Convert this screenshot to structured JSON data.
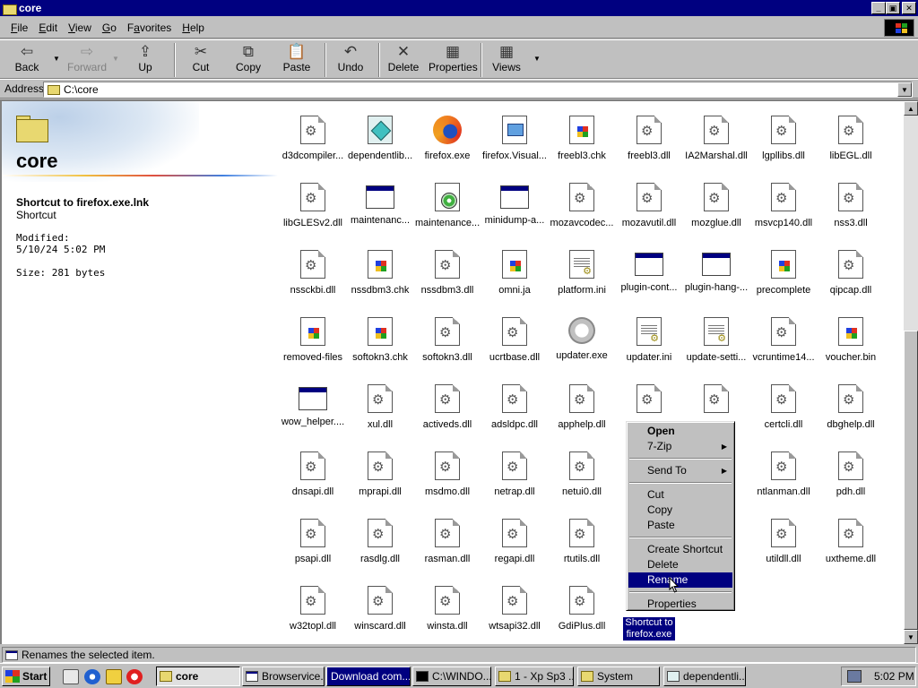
{
  "window": {
    "title": "core",
    "controls": {
      "minimize": "_",
      "maximize": "▣",
      "close": "✕"
    }
  },
  "menubar": {
    "items": [
      {
        "label": "File",
        "mnemonic": "F",
        "rest": "ile"
      },
      {
        "label": "Edit",
        "mnemonic": "E",
        "rest": "dit"
      },
      {
        "label": "View",
        "mnemonic": "V",
        "rest": "iew"
      },
      {
        "label": "Go",
        "mnemonic": "G",
        "rest": "o"
      },
      {
        "label": "Favorites",
        "mnemonic": "a",
        "pre": "F",
        "rest": "vorites"
      },
      {
        "label": "Help",
        "mnemonic": "H",
        "rest": "elp"
      }
    ]
  },
  "toolbar": {
    "back": "Back",
    "forward": "Forward",
    "up": "Up",
    "cut": "Cut",
    "copy": "Copy",
    "paste": "Paste",
    "undo": "Undo",
    "delete": "Delete",
    "properties": "Properties",
    "views": "Views"
  },
  "address": {
    "label": "Address",
    "value": "C:\\core"
  },
  "leftpane": {
    "folder_name": "core",
    "selected_name": "Shortcut to firefox.exe.lnk",
    "selected_type": "Shortcut",
    "modified_label": "Modified:",
    "modified_value": "5/10/24 5:02 PM",
    "size_text": "Size: 281 bytes"
  },
  "files": [
    {
      "label": "d3dcompiler...",
      "icon": "dll"
    },
    {
      "label": "dependentlib...",
      "icon": "depwalk"
    },
    {
      "label": "firefox.exe",
      "icon": "firefox"
    },
    {
      "label": "firefox.Visual...",
      "icon": "vsdoc"
    },
    {
      "label": "freebl3.chk",
      "icon": "winflag"
    },
    {
      "label": "freebl3.dll",
      "icon": "dll"
    },
    {
      "label": "IA2Marshal.dll",
      "icon": "dll"
    },
    {
      "label": "lgpllibs.dll",
      "icon": "dll"
    },
    {
      "label": "libEGL.dll",
      "icon": "dll"
    },
    {
      "label": "libGLESv2.dll",
      "icon": "dll"
    },
    {
      "label": "maintenanc...",
      "icon": "app"
    },
    {
      "label": "maintenance...",
      "icon": "installer"
    },
    {
      "label": "minidump-a...",
      "icon": "app"
    },
    {
      "label": "mozavcodec...",
      "icon": "dll"
    },
    {
      "label": "mozavutil.dll",
      "icon": "dll"
    },
    {
      "label": "mozglue.dll",
      "icon": "dll"
    },
    {
      "label": "msvcp140.dll",
      "icon": "dll"
    },
    {
      "label": "nss3.dll",
      "icon": "dll"
    },
    {
      "label": "nssckbi.dll",
      "icon": "dll"
    },
    {
      "label": "nssdbm3.chk",
      "icon": "winflag"
    },
    {
      "label": "nssdbm3.dll",
      "icon": "dll"
    },
    {
      "label": "omni.ja",
      "icon": "winflag"
    },
    {
      "label": "platform.ini",
      "icon": "ini"
    },
    {
      "label": "plugin-cont...",
      "icon": "app"
    },
    {
      "label": "plugin-hang-...",
      "icon": "app"
    },
    {
      "label": "precomplete",
      "icon": "winflag"
    },
    {
      "label": "qipcap.dll",
      "icon": "dll"
    },
    {
      "label": "removed-files",
      "icon": "winflag"
    },
    {
      "label": "softokn3.chk",
      "icon": "winflag"
    },
    {
      "label": "softokn3.dll",
      "icon": "dll"
    },
    {
      "label": "ucrtbase.dll",
      "icon": "dll"
    },
    {
      "label": "updater.exe",
      "icon": "updater"
    },
    {
      "label": "updater.ini",
      "icon": "ini"
    },
    {
      "label": "update-setti...",
      "icon": "ini"
    },
    {
      "label": "vcruntime14...",
      "icon": "dll"
    },
    {
      "label": "voucher.bin",
      "icon": "winflag"
    },
    {
      "label": "wow_helper....",
      "icon": "app"
    },
    {
      "label": "xul.dll",
      "icon": "dll"
    },
    {
      "label": "activeds.dll",
      "icon": "dll"
    },
    {
      "label": "adsldpc.dll",
      "icon": "dll"
    },
    {
      "label": "apphelp.dll",
      "icon": "dll"
    },
    {
      "label": "",
      "icon": "dll"
    },
    {
      "label": "",
      "icon": "dll"
    },
    {
      "label": "certcli.dll",
      "icon": "dll"
    },
    {
      "label": "dbghelp.dll",
      "icon": "dll"
    },
    {
      "label": "dnsapi.dll",
      "icon": "dll"
    },
    {
      "label": "mprapi.dll",
      "icon": "dll"
    },
    {
      "label": "msdmo.dll",
      "icon": "dll"
    },
    {
      "label": "netrap.dll",
      "icon": "dll"
    },
    {
      "label": "netui0.dll",
      "icon": "dll"
    },
    {
      "label": "",
      "icon": "none"
    },
    {
      "label": "",
      "icon": "none"
    },
    {
      "label": "ntlanman.dll",
      "icon": "dll"
    },
    {
      "label": "pdh.dll",
      "icon": "dll"
    },
    {
      "label": "psapi.dll",
      "icon": "dll"
    },
    {
      "label": "rasdlg.dll",
      "icon": "dll"
    },
    {
      "label": "rasman.dll",
      "icon": "dll"
    },
    {
      "label": "regapi.dll",
      "icon": "dll"
    },
    {
      "label": "rtutils.dll",
      "icon": "dll"
    },
    {
      "label": "",
      "icon": "none"
    },
    {
      "label": "",
      "icon": "none"
    },
    {
      "label": "utildll.dll",
      "icon": "dll"
    },
    {
      "label": "uxtheme.dll",
      "icon": "dll"
    },
    {
      "label": "w32topl.dll",
      "icon": "dll"
    },
    {
      "label": "winscard.dll",
      "icon": "dll"
    },
    {
      "label": "winsta.dll",
      "icon": "dll"
    },
    {
      "label": "wtsapi32.dll",
      "icon": "dll"
    },
    {
      "label": "GdiPlus.dll",
      "icon": "dll"
    },
    {
      "label": "Shortcut to firefox.exe",
      "icon": "none",
      "selected": true
    }
  ],
  "context_menu": {
    "items": [
      {
        "label": "Open",
        "bold": true
      },
      {
        "label": "7-Zip",
        "submenu": true
      },
      {
        "sep": true
      },
      {
        "label": "Send To",
        "submenu": true
      },
      {
        "sep": true
      },
      {
        "label": "Cut"
      },
      {
        "label": "Copy"
      },
      {
        "label": "Paste"
      },
      {
        "sep": true
      },
      {
        "label": "Create Shortcut"
      },
      {
        "label": "Delete"
      },
      {
        "label": "Rename",
        "highlight": true
      },
      {
        "sep": true
      },
      {
        "label": "Properties"
      }
    ]
  },
  "status": {
    "text": "Renames the selected item."
  },
  "taskbar": {
    "start_label": "Start",
    "tasks": [
      {
        "label": "core",
        "icon": "folder",
        "state": "active"
      },
      {
        "label": "Browservice...",
        "icon": "app",
        "state": "normal"
      },
      {
        "label": "Download com...",
        "icon": "none",
        "state": "highlighted"
      },
      {
        "label": "C:\\WINDO...",
        "icon": "cmd",
        "state": "normal"
      },
      {
        "label": "1 - Xp Sp3 ...",
        "icon": "folder",
        "state": "normal"
      },
      {
        "label": "System",
        "icon": "folder",
        "state": "normal"
      },
      {
        "label": "dependentli...",
        "icon": "doc",
        "state": "normal"
      }
    ],
    "clock": "5:02 PM"
  },
  "colors": {
    "titlebar": "#000080",
    "selection": "#000080",
    "face": "#c0c0c0"
  }
}
